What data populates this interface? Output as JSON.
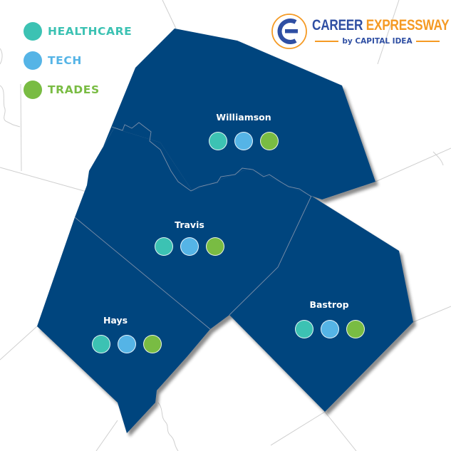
{
  "colors": {
    "county_fill": "#03457e",
    "county_border": "#7a8ea8",
    "background": "#ffffff",
    "background_lines": "#cfcfcf",
    "healthcare": "#3cc2b3",
    "tech": "#55b4e6",
    "trades": "#79bc43",
    "logo_blue": "#2f4fa3",
    "logo_orange": "#f59a24"
  },
  "legend": [
    {
      "key": "healthcare",
      "label": "HEALTHCARE",
      "color": "#3cc2b3",
      "text_color": "#3cc2b3"
    },
    {
      "key": "tech",
      "label": "TECH",
      "color": "#55b4e6",
      "text_color": "#55b4e6"
    },
    {
      "key": "trades",
      "label": "TRADES",
      "color": "#79bc43",
      "text_color": "#79bc43"
    }
  ],
  "logo": {
    "word1": "CAREER",
    "word2": "EXPRESSWAY",
    "tagline": "by CAPITAL IDEA",
    "icon": "letter-e-circle-icon"
  },
  "counties": [
    {
      "name": "Williamson",
      "sectors": [
        "healthcare",
        "tech",
        "trades"
      ]
    },
    {
      "name": "Travis",
      "sectors": [
        "healthcare",
        "tech",
        "trades"
      ]
    },
    {
      "name": "Hays",
      "sectors": [
        "healthcare",
        "tech",
        "trades"
      ]
    },
    {
      "name": "Bastrop",
      "sectors": [
        "healthcare",
        "tech",
        "trades"
      ]
    }
  ]
}
